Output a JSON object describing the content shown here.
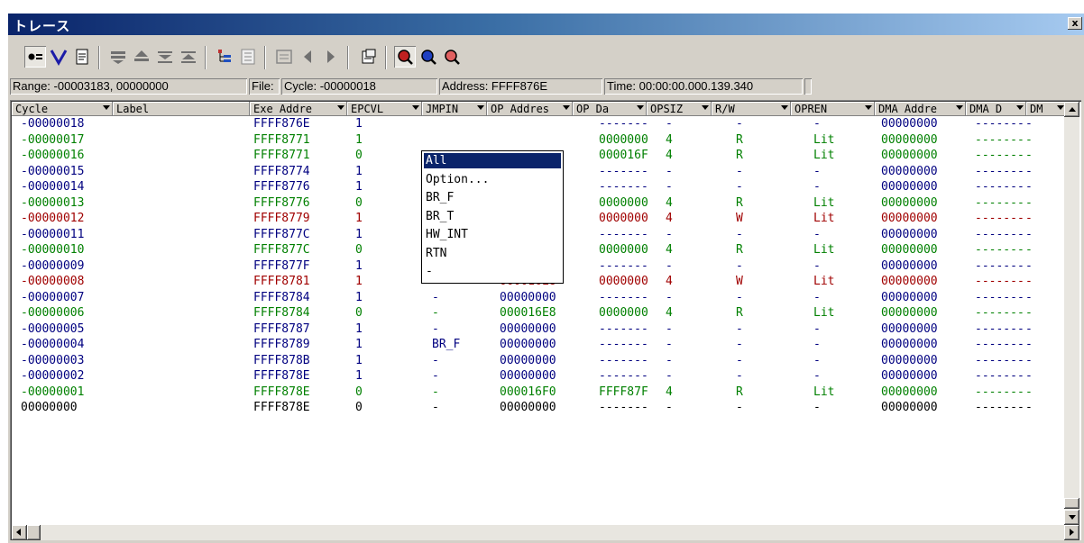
{
  "window": {
    "title": "トレース",
    "close_label": "x"
  },
  "toolbar": {
    "buttons": [
      {
        "icon": "record-icon",
        "pressed": true
      },
      {
        "icon": "filter-v-icon"
      },
      {
        "icon": "document-icon"
      },
      {
        "icon": "move-down-icon"
      },
      {
        "icon": "move-up-icon"
      },
      {
        "icon": "collapse-down-icon"
      },
      {
        "icon": "collapse-up-icon"
      },
      {
        "icon": "tree-icon"
      },
      {
        "icon": "list-icon"
      },
      {
        "icon": "view-icon"
      },
      {
        "icon": "prev-icon"
      },
      {
        "icon": "next-icon"
      },
      {
        "icon": "properties-icon"
      },
      {
        "icon": "zoom-red-icon",
        "pressed": true
      },
      {
        "icon": "zoom-blue-icon"
      },
      {
        "icon": "zoom-red2-icon"
      }
    ]
  },
  "status": {
    "range": "Range: -00003183, 00000000",
    "file": "File:",
    "cycle": "Cycle: -00000018",
    "address": "Address: FFFF876E",
    "time": "Time: 00:00:00.000.139.340"
  },
  "columns": [
    "Cycle",
    "Label",
    "Exe Addre",
    "EPCVL",
    "JMPIN",
    "OP Addres",
    "OP Da",
    "OPSIZ",
    "R/W",
    "OPREN",
    "DMA Addre",
    "DMA D",
    "DM"
  ],
  "colors": {
    "blue": "#000080",
    "green": "#008000",
    "red": "#a00000",
    "black": "#000000",
    "selection": "#0a246a"
  },
  "rows": [
    {
      "color": "blue",
      "cycle": "-00000018",
      "exe": "FFFF876E",
      "epcvl": "1",
      "jmpin": "",
      "opaddr": "",
      "opdata": "-------",
      "opsiz": "-",
      "rw": "-",
      "opren": "-",
      "dma": "00000000",
      "dmad": "-------",
      "dm": "-"
    },
    {
      "color": "green",
      "cycle": "-00000017",
      "exe": "FFFF8771",
      "epcvl": "1",
      "jmpin": "",
      "opaddr": "",
      "opdata": "0000000",
      "opsiz": "4",
      "rw": "R",
      "opren": "Lit",
      "dma": "00000000",
      "dmad": "-------",
      "dm": "-"
    },
    {
      "color": "green",
      "cycle": "-00000016",
      "exe": "FFFF8771",
      "epcvl": "0",
      "jmpin": "",
      "opaddr": "",
      "opdata": "000016F",
      "opsiz": "4",
      "rw": "R",
      "opren": "Lit",
      "dma": "00000000",
      "dmad": "-------",
      "dm": "-"
    },
    {
      "color": "blue",
      "cycle": "-00000015",
      "exe": "FFFF8774",
      "epcvl": "1",
      "jmpin": "",
      "opaddr": "",
      "opdata": "-------",
      "opsiz": "-",
      "rw": "-",
      "opren": "-",
      "dma": "00000000",
      "dmad": "-------",
      "dm": "-"
    },
    {
      "color": "blue",
      "cycle": "-00000014",
      "exe": "FFFF8776",
      "epcvl": "1",
      "jmpin": "",
      "opaddr": "",
      "opdata": "-------",
      "opsiz": "-",
      "rw": "-",
      "opren": "-",
      "dma": "00000000",
      "dmad": "-------",
      "dm": "-"
    },
    {
      "color": "green",
      "cycle": "-00000013",
      "exe": "FFFF8776",
      "epcvl": "0",
      "jmpin": "",
      "opaddr": "",
      "opdata": "0000000",
      "opsiz": "4",
      "rw": "R",
      "opren": "Lit",
      "dma": "00000000",
      "dmad": "-------",
      "dm": "-"
    },
    {
      "color": "red",
      "cycle": "-00000012",
      "exe": "FFFF8779",
      "epcvl": "1",
      "jmpin": "",
      "opaddr": "",
      "opdata": "0000000",
      "opsiz": "4",
      "rw": "W",
      "opren": "Lit",
      "dma": "00000000",
      "dmad": "-------",
      "dm": "-"
    },
    {
      "color": "blue",
      "cycle": "-00000011",
      "exe": "FFFF877C",
      "epcvl": "1",
      "jmpin": "-",
      "opaddr": "00000000",
      "opdata": "-------",
      "opsiz": "-",
      "rw": "-",
      "opren": "-",
      "dma": "00000000",
      "dmad": "-------",
      "dm": "-"
    },
    {
      "color": "green",
      "cycle": "-00000010",
      "exe": "FFFF877C",
      "epcvl": "0",
      "jmpin": "-",
      "opaddr": "000016E8",
      "opdata": "0000000",
      "opsiz": "4",
      "rw": "R",
      "opren": "Lit",
      "dma": "00000000",
      "dmad": "-------",
      "dm": "-"
    },
    {
      "color": "blue",
      "cycle": "-00000009",
      "exe": "FFFF877F",
      "epcvl": "1",
      "jmpin": "-",
      "opaddr": "00000000",
      "opdata": "-------",
      "opsiz": "-",
      "rw": "-",
      "opren": "-",
      "dma": "00000000",
      "dmad": "-------",
      "dm": "-"
    },
    {
      "color": "red",
      "cycle": "-00000008",
      "exe": "FFFF8781",
      "epcvl": "1",
      "jmpin": "-",
      "opaddr": "000016E8",
      "opdata": "0000000",
      "opsiz": "4",
      "rw": "W",
      "opren": "Lit",
      "dma": "00000000",
      "dmad": "-------",
      "dm": "-"
    },
    {
      "color": "blue",
      "cycle": "-00000007",
      "exe": "FFFF8784",
      "epcvl": "1",
      "jmpin": "-",
      "opaddr": "00000000",
      "opdata": "-------",
      "opsiz": "-",
      "rw": "-",
      "opren": "-",
      "dma": "00000000",
      "dmad": "-------",
      "dm": "-"
    },
    {
      "color": "green",
      "cycle": "-00000006",
      "exe": "FFFF8784",
      "epcvl": "0",
      "jmpin": "-",
      "opaddr": "000016E8",
      "opdata": "0000000",
      "opsiz": "4",
      "rw": "R",
      "opren": "Lit",
      "dma": "00000000",
      "dmad": "-------",
      "dm": "-"
    },
    {
      "color": "blue",
      "cycle": "-00000005",
      "exe": "FFFF8787",
      "epcvl": "1",
      "jmpin": "-",
      "opaddr": "00000000",
      "opdata": "-------",
      "opsiz": "-",
      "rw": "-",
      "opren": "-",
      "dma": "00000000",
      "dmad": "-------",
      "dm": "-"
    },
    {
      "color": "blue",
      "cycle": "-00000004",
      "exe": "FFFF8789",
      "epcvl": "1",
      "jmpin": "BR_F",
      "opaddr": "00000000",
      "opdata": "-------",
      "opsiz": "-",
      "rw": "-",
      "opren": "-",
      "dma": "00000000",
      "dmad": "-------",
      "dm": "-"
    },
    {
      "color": "blue",
      "cycle": "-00000003",
      "exe": "FFFF878B",
      "epcvl": "1",
      "jmpin": "-",
      "opaddr": "00000000",
      "opdata": "-------",
      "opsiz": "-",
      "rw": "-",
      "opren": "-",
      "dma": "00000000",
      "dmad": "-------",
      "dm": "-"
    },
    {
      "color": "blue",
      "cycle": "-00000002",
      "exe": "FFFF878E",
      "epcvl": "1",
      "jmpin": "-",
      "opaddr": "00000000",
      "opdata": "-------",
      "opsiz": "-",
      "rw": "-",
      "opren": "-",
      "dma": "00000000",
      "dmad": "-------",
      "dm": "-"
    },
    {
      "color": "green",
      "cycle": "-00000001",
      "exe": "FFFF878E",
      "epcvl": "0",
      "jmpin": "-",
      "opaddr": "000016F0",
      "opdata": "FFFF87F",
      "opsiz": "4",
      "rw": "R",
      "opren": "Lit",
      "dma": "00000000",
      "dmad": "-------",
      "dm": "-"
    },
    {
      "color": "black",
      "cycle": "00000000",
      "exe": "FFFF878E",
      "epcvl": "0",
      "jmpin": "-",
      "opaddr": "00000000",
      "opdata": "-------",
      "opsiz": "-",
      "rw": "-",
      "opren": "-",
      "dma": "00000000",
      "dmad": "-------",
      "dm": "-"
    }
  ],
  "dropdown": {
    "options": [
      "All",
      "Option...",
      "BR_F",
      "BR_T",
      "HW_INT",
      "RTN",
      "-"
    ],
    "selected": 0
  }
}
